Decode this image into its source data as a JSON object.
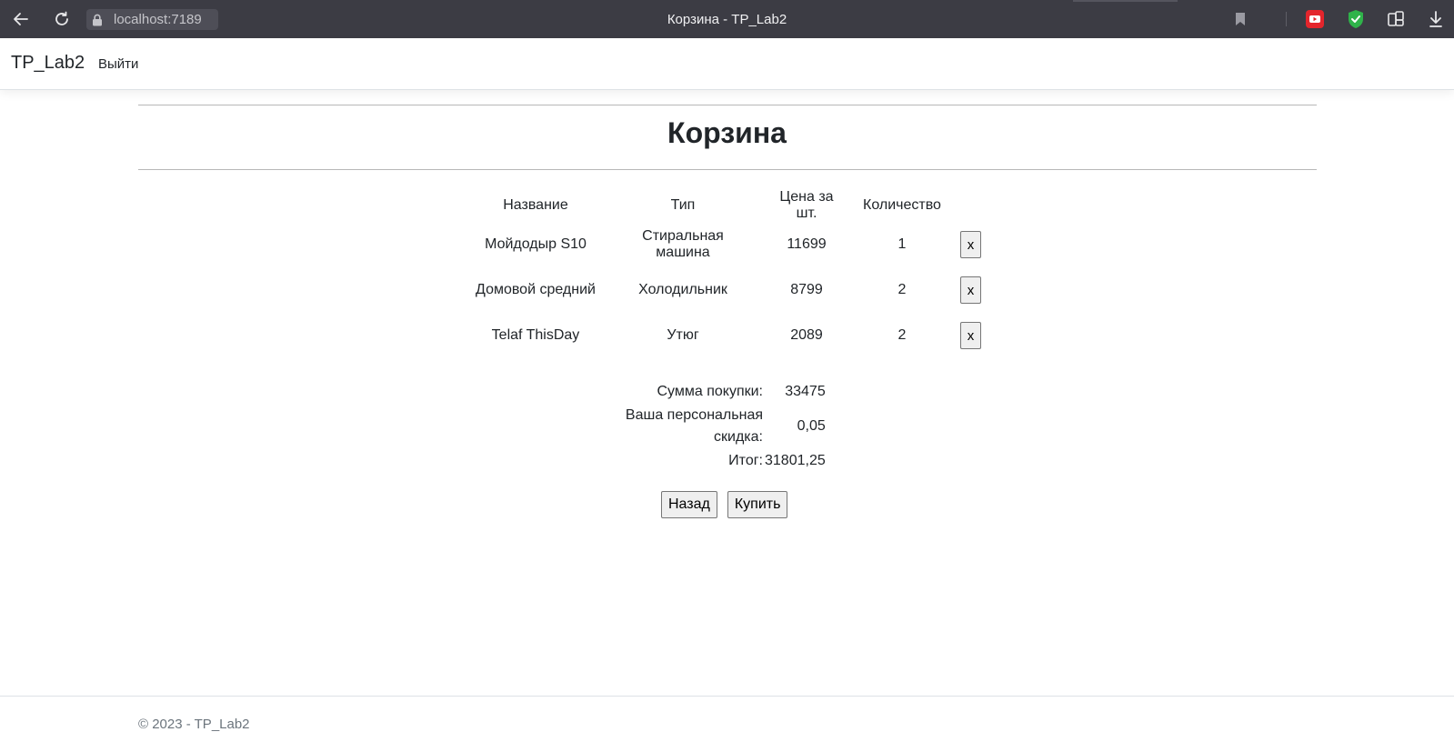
{
  "browser": {
    "url": "localhost:7189",
    "tab_title": "Корзина - TP_Lab2",
    "icons": [
      "back-icon",
      "reload-icon",
      "lock-icon",
      "bookmark-icon",
      "youtube-icon",
      "shield-icon",
      "extensions-icon",
      "download-icon"
    ],
    "colors": {
      "chrome_bg": "#3c3c44",
      "youtube_red": "#e4252c",
      "shield_green": "#2fb34a"
    }
  },
  "navbar": {
    "brand": "TP_Lab2",
    "logout_label": "Выйти"
  },
  "page": {
    "title": "Корзина"
  },
  "cart": {
    "headers": [
      "Название",
      "Тип",
      "Цена за шт.",
      "Количество"
    ],
    "rows": [
      {
        "name": "Мойдодыр S10",
        "type": "Стиральная машина",
        "price": "11699",
        "qty": "1",
        "remove_label": "x"
      },
      {
        "name": "Домовой средний",
        "type": "Холодильник",
        "price": "8799",
        "qty": "2",
        "remove_label": "x"
      },
      {
        "name": "Telaf ThisDay",
        "type": "Утюг",
        "price": "2089",
        "qty": "2",
        "remove_label": "x"
      }
    ]
  },
  "summary": {
    "sum_label": "Сумма покупки:",
    "sum_value": "33475",
    "discount_label": "Ваша персональная скидка:",
    "discount_value": "0,05",
    "total_label": "Итог:",
    "total_value": "31801,25"
  },
  "actions": {
    "back_label": "Назад",
    "buy_label": "Купить"
  },
  "footer": {
    "text": "© 2023 - TP_Lab2"
  }
}
